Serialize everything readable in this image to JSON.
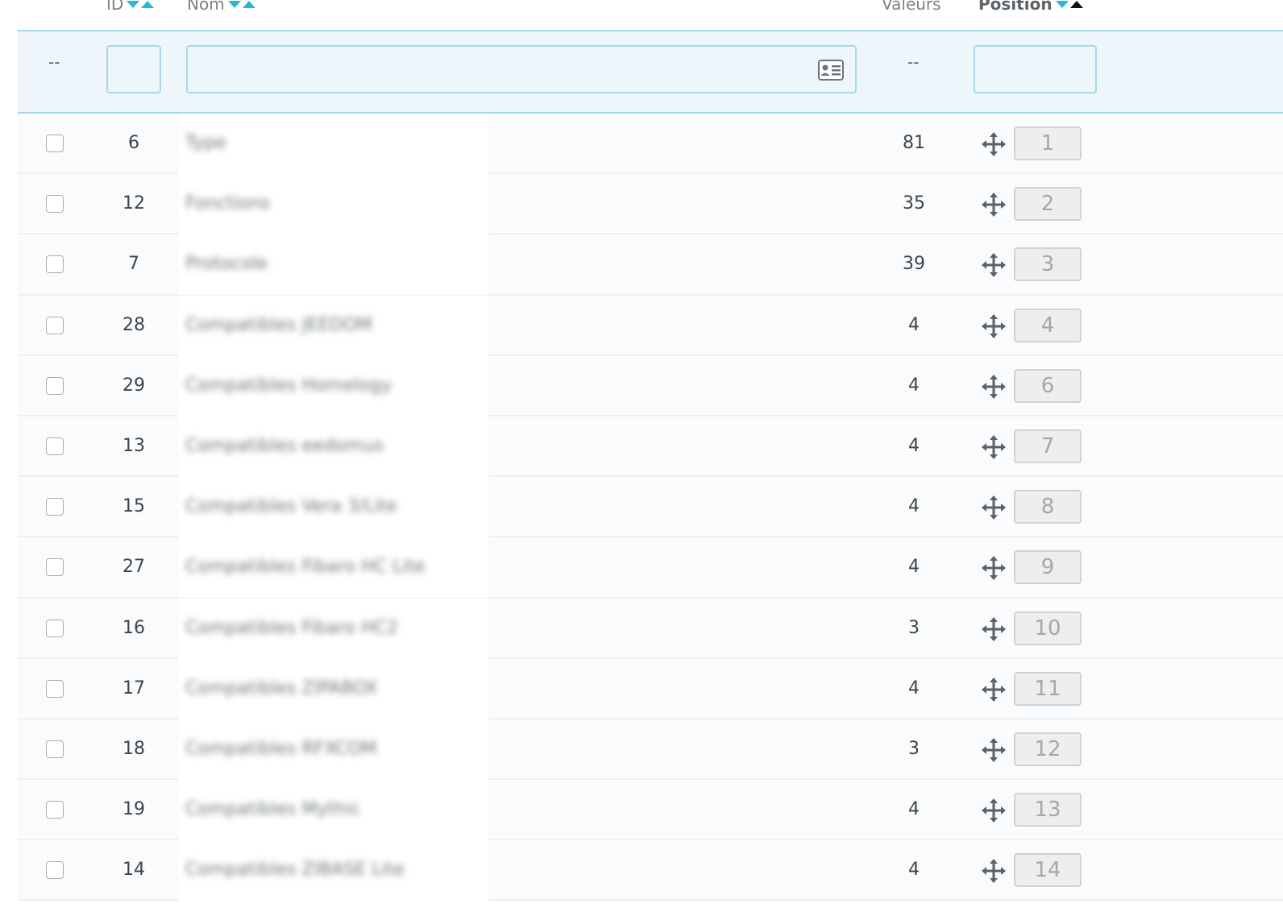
{
  "header": {
    "id_label": "ID",
    "name_label": "Nom",
    "values_label": "Valeurs",
    "position_label": "Position"
  },
  "filter": {
    "bulk_placeholder": "--",
    "values_placeholder": "--",
    "id_value": "",
    "name_value": "",
    "position_value": ""
  },
  "colors": {
    "accent": "#25b9d7",
    "filter_bg": "#eef6fb",
    "filter_border": "#a6d8e9"
  },
  "rows": [
    {
      "id": "6",
      "name": "Type",
      "values": "81",
      "position": "1"
    },
    {
      "id": "12",
      "name": "Fonctions",
      "values": "35",
      "position": "2"
    },
    {
      "id": "7",
      "name": "Protocole",
      "values": "39",
      "position": "3"
    },
    {
      "id": "28",
      "name": "Compatibles JEEDOM",
      "values": "4",
      "position": "4"
    },
    {
      "id": "29",
      "name": "Compatibles Homelogy",
      "values": "4",
      "position": "6"
    },
    {
      "id": "13",
      "name": "Compatibles eedomus",
      "values": "4",
      "position": "7"
    },
    {
      "id": "15",
      "name": "Compatibles Vera 3/Lite",
      "values": "4",
      "position": "8"
    },
    {
      "id": "27",
      "name": "Compatibles Fibaro HC Lite",
      "values": "4",
      "position": "9"
    },
    {
      "id": "16",
      "name": "Compatibles Fibaro HC2",
      "values": "3",
      "position": "10"
    },
    {
      "id": "17",
      "name": "Compatibles ZIPABOX",
      "values": "4",
      "position": "11"
    },
    {
      "id": "18",
      "name": "Compatibles RFXCOM",
      "values": "3",
      "position": "12"
    },
    {
      "id": "19",
      "name": "Compatibles Mythic",
      "values": "4",
      "position": "13"
    },
    {
      "id": "14",
      "name": "Compatibles ZIBASE Lite",
      "values": "4",
      "position": "14"
    }
  ]
}
